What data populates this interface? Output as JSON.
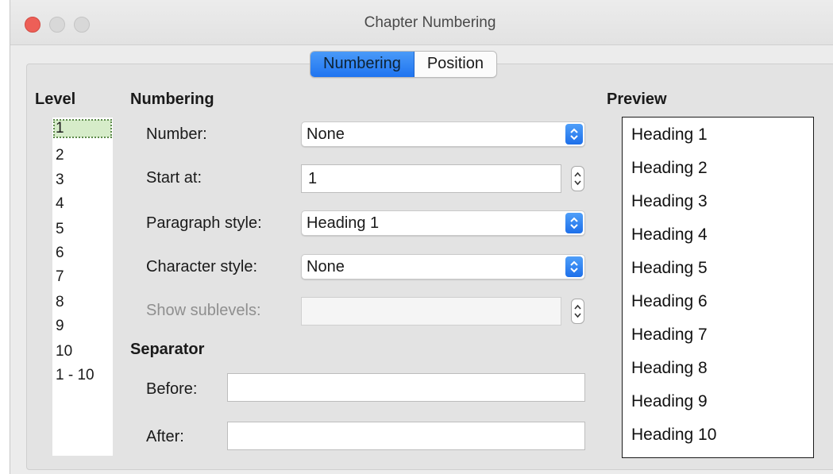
{
  "window": {
    "title": "Chapter Numbering"
  },
  "tabs": [
    {
      "label": "Numbering",
      "active": true
    },
    {
      "label": "Position",
      "active": false
    }
  ],
  "level": {
    "header": "Level",
    "items": [
      "1",
      "2",
      "3",
      "4",
      "5",
      "6",
      "7",
      "8",
      "9",
      "10",
      "1 - 10"
    ],
    "selected": "1"
  },
  "numbering": {
    "header": "Numbering",
    "number_label": "Number:",
    "number_value": "None",
    "start_label": "Start at:",
    "start_value": "1",
    "para_label": "Paragraph style:",
    "para_value": "Heading 1",
    "char_label": "Character style:",
    "char_value": "None",
    "sublevels_label": "Show sublevels:",
    "sublevels_value": ""
  },
  "separator": {
    "header": "Separator",
    "before_label": "Before:",
    "before_value": "",
    "after_label": "After:",
    "after_value": ""
  },
  "preview": {
    "header": "Preview",
    "items": [
      "Heading 1",
      "Heading 2",
      "Heading 3",
      "Heading 4",
      "Heading 5",
      "Heading 6",
      "Heading 7",
      "Heading 8",
      "Heading 9",
      "Heading 10"
    ]
  },
  "colors": {
    "accent": "#1f74f0",
    "close_button": "#ed5f57",
    "selected_level": "#d6ecc9"
  },
  "icons": [
    "close-window-icon",
    "minimize-window-icon",
    "zoom-window-icon",
    "dropdown-arrows-icon",
    "stepper-arrows-icon"
  ]
}
